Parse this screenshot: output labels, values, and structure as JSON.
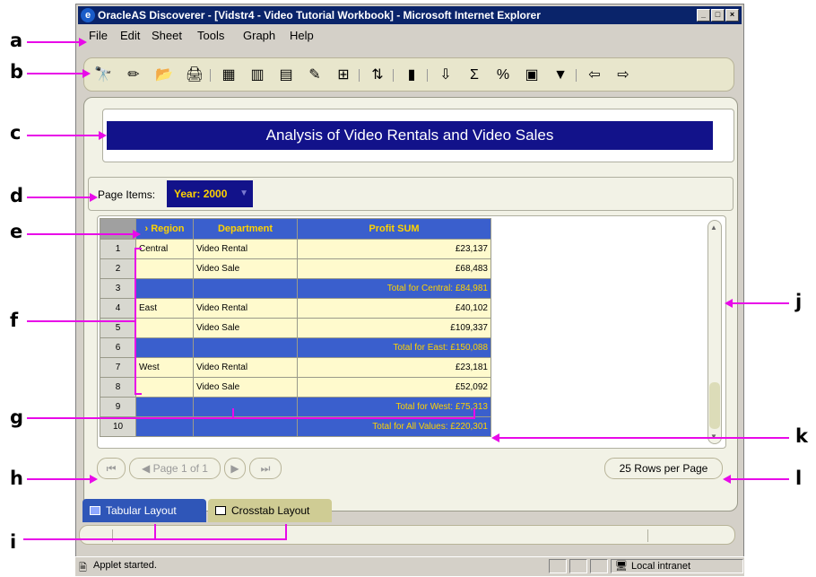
{
  "window": {
    "title": "OracleAS Discoverer - [Vidstr4 - Video Tutorial Workbook] - Microsoft Internet Explorer",
    "controls": [
      "_",
      "□",
      "×"
    ]
  },
  "menu": [
    "File",
    "Edit",
    "Sheet",
    "Tools",
    "Graph",
    "Help"
  ],
  "toolbar": {
    "icons": [
      "binoculars-icon",
      "wand-icon",
      "open-folder-icon",
      "print-icon",
      "format-icon",
      "table-icon",
      "sheet-icon",
      "chart-edit-icon",
      "crosstab-icon",
      "sort-icon",
      "graph-icon",
      "export-icon",
      "sum-icon",
      "percent-icon",
      "calc-icon",
      "filter-icon",
      "import-icon",
      "export-sheet-icon"
    ],
    "glyphs": [
      "🔭",
      "✏",
      "📂",
      "🖨",
      "▦",
      "▥",
      "▤",
      "✎",
      "⊞",
      "⇅",
      "▮",
      "⇩",
      "Σ",
      "%",
      "▣",
      "▼",
      "⇦",
      "⇨"
    ]
  },
  "report": {
    "title": "Analysis of Video Rentals and Video Sales"
  },
  "page_items": {
    "label": "Page Items:",
    "value": "Year: 2000"
  },
  "table": {
    "headers": [
      "",
      "Region",
      "Department",
      "Profit SUM"
    ],
    "rows": [
      {
        "n": "1",
        "region": "Central",
        "dept": "Video Rental",
        "profit": "£23,137",
        "type": "data"
      },
      {
        "n": "2",
        "region": "",
        "dept": "Video Sale",
        "profit": "£68,483",
        "type": "data"
      },
      {
        "n": "3",
        "region": "",
        "dept": "",
        "profit": "Total for Central: £84,981",
        "type": "total"
      },
      {
        "n": "4",
        "region": "East",
        "dept": "Video Rental",
        "profit": "£40,102",
        "type": "data"
      },
      {
        "n": "5",
        "region": "",
        "dept": "Video Sale",
        "profit": "£109,337",
        "type": "data"
      },
      {
        "n": "6",
        "region": "",
        "dept": "",
        "profit": "Total for East: £150,088",
        "type": "total"
      },
      {
        "n": "7",
        "region": "West",
        "dept": "Video Rental",
        "profit": "£23,181",
        "type": "data"
      },
      {
        "n": "8",
        "region": "",
        "dept": "Video Sale",
        "profit": "£52,092",
        "type": "data"
      },
      {
        "n": "9",
        "region": "",
        "dept": "",
        "profit": "Total for West: £75,313",
        "type": "total"
      },
      {
        "n": "10",
        "region": "",
        "dept": "",
        "profit": "Total for All Values: £220,301",
        "type": "total"
      }
    ]
  },
  "pagination": {
    "page_label": "Page 1 of 1",
    "rows_per_page": "25 Rows per Page"
  },
  "tabs": [
    "Tabular Layout",
    "Crosstab Layout"
  ],
  "status": {
    "text": "Applet started.",
    "zone": "Local intranet"
  },
  "callouts": [
    "a",
    "b",
    "c",
    "d",
    "e",
    "f",
    "g",
    "h",
    "i",
    "j",
    "k",
    "l"
  ],
  "colors": {
    "title_bg": "#12128a",
    "header_bg": "#3a5fcd",
    "header_text": "#ffd200",
    "data_bg": "#fffacd",
    "callout_line": "#e80ae8"
  }
}
